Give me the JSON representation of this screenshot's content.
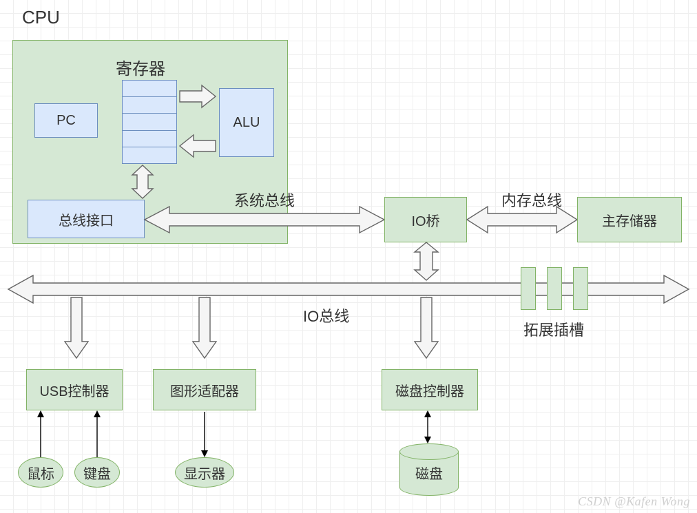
{
  "labels": {
    "cpu": "CPU",
    "pc": "PC",
    "registers": "寄存器",
    "alu": "ALU",
    "bus_if": "总线接口",
    "sys_bus": "系统总线",
    "io_bridge": "IO桥",
    "mem_bus": "内存总线",
    "main_mem": "主存储器",
    "io_bus": "IO总线",
    "exp_slots": "拓展插槽",
    "usb_ctrl": "USB控制器",
    "gfx_adapter": "图形适配器",
    "disk_ctrl": "磁盘控制器",
    "mouse": "鼠标",
    "keyboard": "键盘",
    "display": "显示器",
    "disk": "磁盘"
  },
  "watermark": "CSDN @Kafen Wong",
  "colors": {
    "green_fill": "#d5e8d4",
    "green_stroke": "#82b366",
    "blue_fill": "#dae8fc",
    "blue_stroke": "#6c8ebf",
    "arrow_fill": "#f5f5f5",
    "arrow_stroke": "#666666"
  }
}
